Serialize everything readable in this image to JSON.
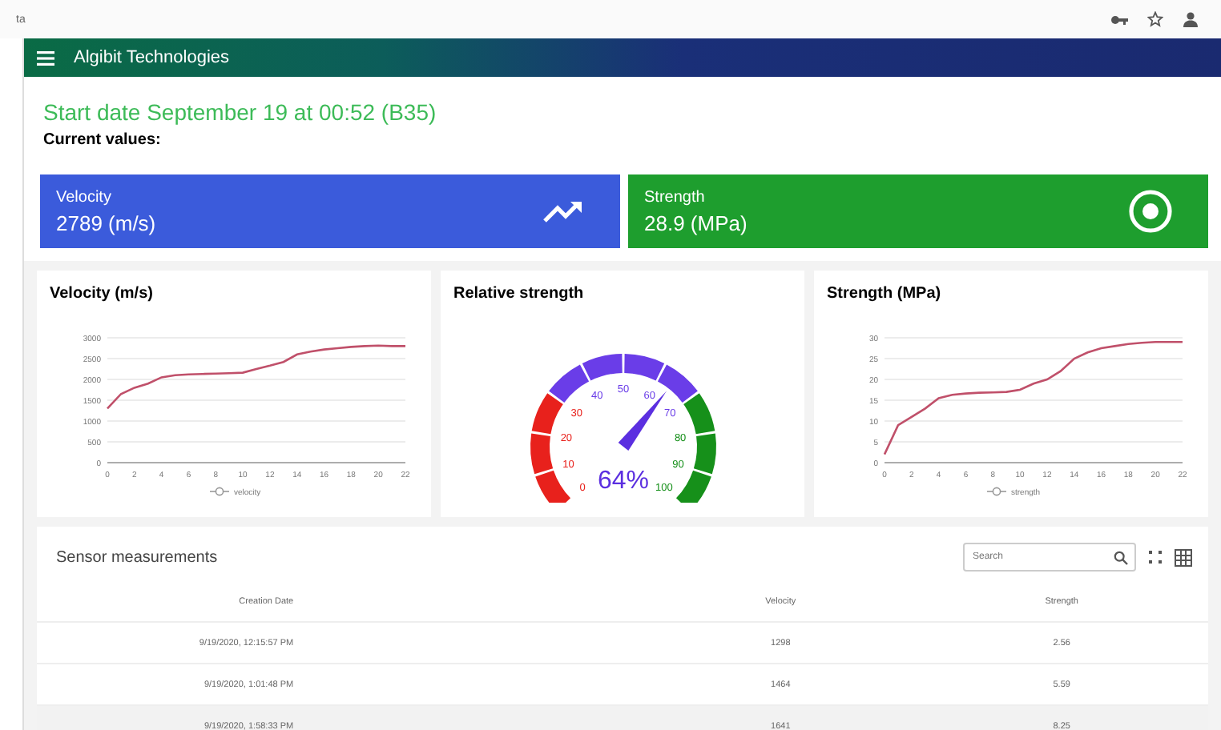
{
  "browser": {
    "tab_text": "ta"
  },
  "app_bar": {
    "title": "Algibit Technologies"
  },
  "start_date": "Start date September 19 at 00:52 (B35)",
  "current_values_label": "Current values:",
  "value_cards": [
    {
      "kind": "velocity",
      "label": "Velocity",
      "value": "2789 (m/s)",
      "color": "#3b5bdb"
    },
    {
      "kind": "strength",
      "label": "Strength",
      "value": "28.9 (MPa)",
      "color": "#1e9e2e"
    }
  ],
  "charts": [
    {
      "title": "Velocity (m/s)",
      "chart_data": {
        "type": "line",
        "x": [
          0,
          1,
          2,
          3,
          4,
          5,
          6,
          7,
          8,
          9,
          10,
          11,
          12,
          13,
          14,
          15,
          16,
          17,
          18,
          19,
          20,
          21,
          22
        ],
        "series": [
          {
            "name": "velocity",
            "color": "#c0506a",
            "values": [
              1300,
              1650,
              1800,
              1900,
              2050,
              2100,
              2120,
              2130,
              2140,
              2150,
              2160,
              2250,
              2330,
              2420,
              2600,
              2670,
              2720,
              2750,
              2780,
              2800,
              2810,
              2800,
              2800
            ]
          }
        ],
        "xlim": [
          0,
          22
        ],
        "ylim": [
          0,
          3000
        ],
        "xticks": [
          0,
          2,
          4,
          6,
          8,
          10,
          12,
          14,
          16,
          18,
          20,
          22
        ],
        "yticks": [
          0,
          500,
          1000,
          1500,
          2000,
          2500,
          3000
        ],
        "grid": true
      }
    },
    {
      "title": "Strength (MPa)",
      "chart_data": {
        "type": "line",
        "x": [
          0,
          1,
          2,
          3,
          4,
          5,
          6,
          7,
          8,
          9,
          10,
          11,
          12,
          13,
          14,
          15,
          16,
          17,
          18,
          19,
          20,
          21,
          22
        ],
        "series": [
          {
            "name": "strength",
            "color": "#c0506a",
            "values": [
              2,
              9,
              11,
              13,
              15.5,
              16.3,
              16.6,
              16.8,
              16.9,
              17,
              17.5,
              19,
              20,
              22,
              25,
              26.5,
              27.5,
              28,
              28.5,
              28.8,
              29,
              29,
              29
            ]
          }
        ],
        "xlim": [
          0,
          22
        ],
        "ylim": [
          0,
          30
        ],
        "xticks": [
          0,
          2,
          4,
          6,
          8,
          10,
          12,
          14,
          16,
          18,
          20,
          22
        ],
        "yticks": [
          0,
          5,
          10,
          15,
          20,
          25,
          30
        ],
        "grid": true
      }
    }
  ],
  "gauge": {
    "title": "Relative strength",
    "reading": "64%",
    "ticks": [
      "0",
      "10",
      "20",
      "30",
      "40",
      "50",
      "60",
      "70",
      "80",
      "90",
      "100"
    ]
  },
  "table": {
    "title": "Sensor measurements",
    "search": {
      "placeholder": "Search"
    },
    "columns": [
      "Creation Date",
      "Velocity",
      "Strength"
    ],
    "rows": [
      {
        "cells": [
          "9/19/2020, 12:15:57 PM",
          "1298",
          "2.56"
        ],
        "highlighted": false
      },
      {
        "cells": [
          "9/19/2020, 1:01:48 PM",
          "1464",
          "5.59"
        ],
        "highlighted": false
      },
      {
        "cells": [
          "9/19/2020, 1:58:33 PM",
          "1641",
          "8.25"
        ],
        "highlighted": true
      }
    ]
  }
}
